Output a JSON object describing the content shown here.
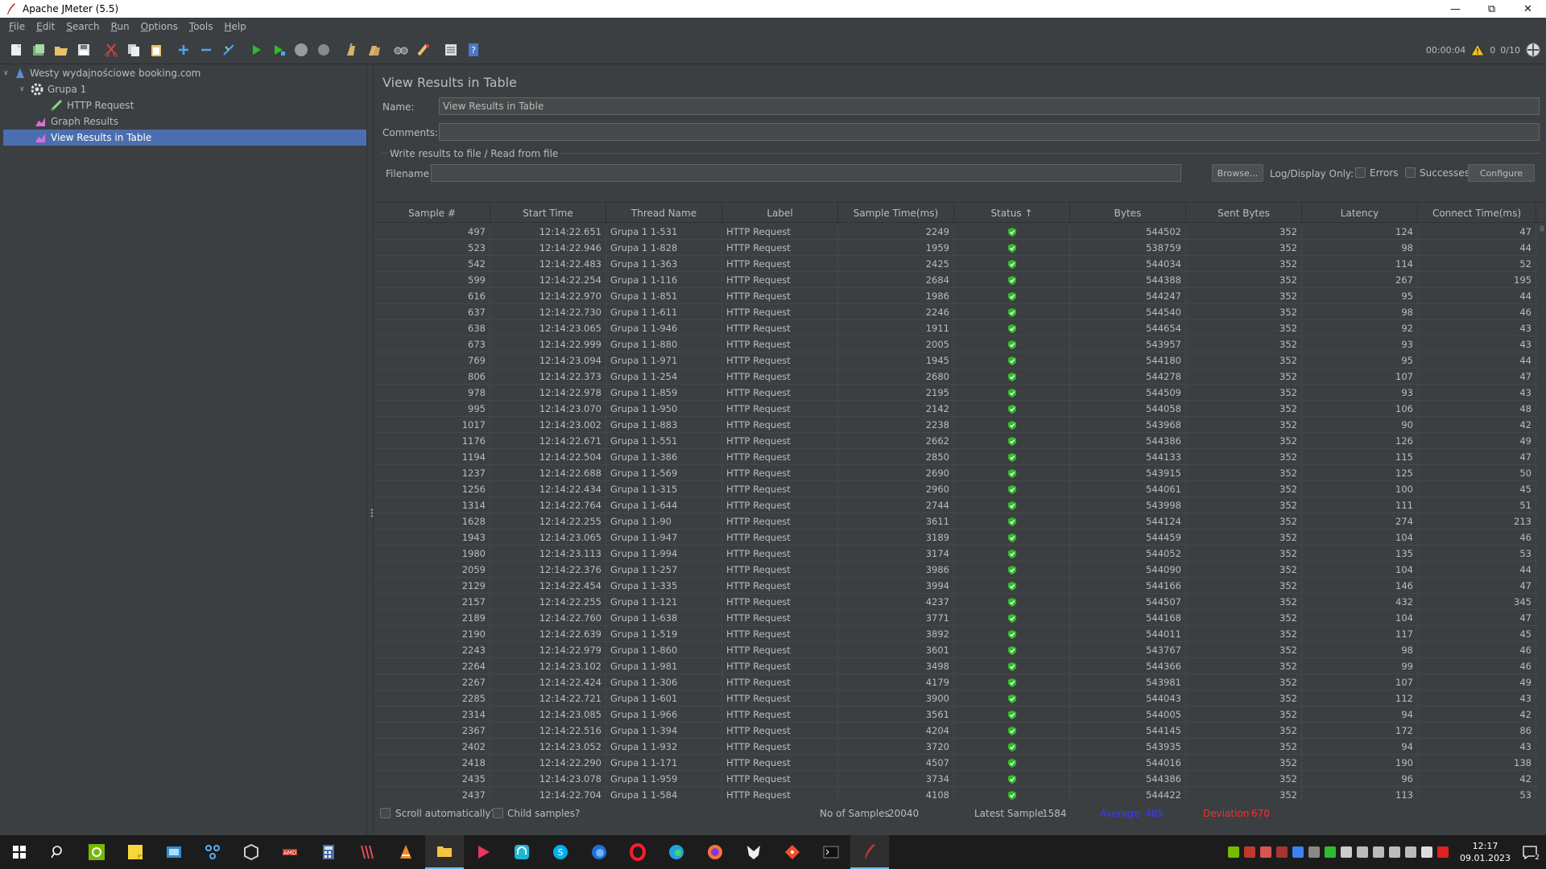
{
  "window": {
    "title": "Apache JMeter (5.5)"
  },
  "menu": [
    "File",
    "Edit",
    "Search",
    "Run",
    "Options",
    "Tools",
    "Help"
  ],
  "toolbar": {
    "timer": "00:00:04",
    "warnings": "0",
    "threads": "0/10",
    "icons": [
      "new-icon",
      "templates-icon",
      "open-icon",
      "save-icon",
      "cut-icon",
      "copy-icon",
      "paste-icon",
      "expand-icon",
      "collapse-icon",
      "toggle-icon",
      "start-icon",
      "start-no-pauses-icon",
      "stop-icon",
      "shutdown-icon",
      "clear-icon",
      "clear-all-icon",
      "search-icon",
      "reset-search-icon",
      "function-helper-icon",
      "help-icon"
    ]
  },
  "tree": {
    "nodes": [
      {
        "label": "Westy wydajnościowe booking.com",
        "icon": "test-plan-icon"
      },
      {
        "label": "Grupa 1",
        "icon": "thread-group-icon"
      },
      {
        "label": "HTTP Request",
        "icon": "sampler-icon"
      },
      {
        "label": "Graph Results",
        "icon": "listener-icon"
      },
      {
        "label": "View Results in Table",
        "icon": "listener-icon"
      }
    ]
  },
  "panel": {
    "title": "View Results in Table",
    "name_label": "Name:",
    "name_value": "View Results in Table",
    "comments_label": "Comments:",
    "comments_value": "",
    "file_group_label": "Write results to file / Read from file",
    "filename_label": "Filename",
    "filename_value": "",
    "browse_label": "Browse...",
    "log_display_label": "Log/Display Only:",
    "errors_label": "Errors",
    "successes_label": "Successes",
    "configure_label": "Configure"
  },
  "table": {
    "columns": [
      "Sample #",
      "Start Time",
      "Thread Name",
      "Label",
      "Sample Time(ms)",
      "Status ↑",
      "Bytes",
      "Sent Bytes",
      "Latency",
      "Connect Time(ms)"
    ],
    "rows": [
      [
        "497",
        "12:14:22.651",
        "Grupa 1 1-531",
        "HTTP Request",
        "2249",
        "544502",
        "352",
        "124",
        "47"
      ],
      [
        "523",
        "12:14:22.946",
        "Grupa 1 1-828",
        "HTTP Request",
        "1959",
        "538759",
        "352",
        "98",
        "44"
      ],
      [
        "542",
        "12:14:22.483",
        "Grupa 1 1-363",
        "HTTP Request",
        "2425",
        "544034",
        "352",
        "114",
        "52"
      ],
      [
        "599",
        "12:14:22.254",
        "Grupa 1 1-116",
        "HTTP Request",
        "2684",
        "544388",
        "352",
        "267",
        "195"
      ],
      [
        "616",
        "12:14:22.970",
        "Grupa 1 1-851",
        "HTTP Request",
        "1986",
        "544247",
        "352",
        "95",
        "44"
      ],
      [
        "637",
        "12:14:22.730",
        "Grupa 1 1-611",
        "HTTP Request",
        "2246",
        "544540",
        "352",
        "98",
        "46"
      ],
      [
        "638",
        "12:14:23.065",
        "Grupa 1 1-946",
        "HTTP Request",
        "1911",
        "544654",
        "352",
        "92",
        "43"
      ],
      [
        "673",
        "12:14:22.999",
        "Grupa 1 1-880",
        "HTTP Request",
        "2005",
        "543957",
        "352",
        "93",
        "43"
      ],
      [
        "769",
        "12:14:23.094",
        "Grupa 1 1-971",
        "HTTP Request",
        "1945",
        "544180",
        "352",
        "95",
        "44"
      ],
      [
        "806",
        "12:14:22.373",
        "Grupa 1 1-254",
        "HTTP Request",
        "2680",
        "544278",
        "352",
        "107",
        "47"
      ],
      [
        "978",
        "12:14:22.978",
        "Grupa 1 1-859",
        "HTTP Request",
        "2195",
        "544509",
        "352",
        "93",
        "43"
      ],
      [
        "995",
        "12:14:23.070",
        "Grupa 1 1-950",
        "HTTP Request",
        "2142",
        "544058",
        "352",
        "106",
        "48"
      ],
      [
        "1017",
        "12:14:23.002",
        "Grupa 1 1-883",
        "HTTP Request",
        "2238",
        "543968",
        "352",
        "90",
        "42"
      ],
      [
        "1176",
        "12:14:22.671",
        "Grupa 1 1-551",
        "HTTP Request",
        "2662",
        "544386",
        "352",
        "126",
        "49"
      ],
      [
        "1194",
        "12:14:22.504",
        "Grupa 1 1-386",
        "HTTP Request",
        "2850",
        "544133",
        "352",
        "115",
        "47"
      ],
      [
        "1237",
        "12:14:22.688",
        "Grupa 1 1-569",
        "HTTP Request",
        "2690",
        "543915",
        "352",
        "125",
        "50"
      ],
      [
        "1256",
        "12:14:22.434",
        "Grupa 1 1-315",
        "HTTP Request",
        "2960",
        "544061",
        "352",
        "100",
        "45"
      ],
      [
        "1314",
        "12:14:22.764",
        "Grupa 1 1-644",
        "HTTP Request",
        "2744",
        "543998",
        "352",
        "111",
        "51"
      ],
      [
        "1628",
        "12:14:22.255",
        "Grupa 1 1-90",
        "HTTP Request",
        "3611",
        "544124",
        "352",
        "274",
        "213"
      ],
      [
        "1943",
        "12:14:23.065",
        "Grupa 1 1-947",
        "HTTP Request",
        "3189",
        "544459",
        "352",
        "104",
        "46"
      ],
      [
        "1980",
        "12:14:23.113",
        "Grupa 1 1-994",
        "HTTP Request",
        "3174",
        "544052",
        "352",
        "135",
        "53"
      ],
      [
        "2059",
        "12:14:22.376",
        "Grupa 1 1-257",
        "HTTP Request",
        "3986",
        "544090",
        "352",
        "104",
        "44"
      ],
      [
        "2129",
        "12:14:22.454",
        "Grupa 1 1-335",
        "HTTP Request",
        "3994",
        "544166",
        "352",
        "146",
        "47"
      ],
      [
        "2157",
        "12:14:22.255",
        "Grupa 1 1-121",
        "HTTP Request",
        "4237",
        "544507",
        "352",
        "432",
        "345"
      ],
      [
        "2189",
        "12:14:22.760",
        "Grupa 1 1-638",
        "HTTP Request",
        "3771",
        "544168",
        "352",
        "104",
        "47"
      ],
      [
        "2190",
        "12:14:22.639",
        "Grupa 1 1-519",
        "HTTP Request",
        "3892",
        "544011",
        "352",
        "117",
        "45"
      ],
      [
        "2243",
        "12:14:22.979",
        "Grupa 1 1-860",
        "HTTP Request",
        "3601",
        "543767",
        "352",
        "98",
        "46"
      ],
      [
        "2264",
        "12:14:23.102",
        "Grupa 1 1-981",
        "HTTP Request",
        "3498",
        "544366",
        "352",
        "99",
        "46"
      ],
      [
        "2267",
        "12:14:22.424",
        "Grupa 1 1-306",
        "HTTP Request",
        "4179",
        "543981",
        "352",
        "107",
        "49"
      ],
      [
        "2285",
        "12:14:22.721",
        "Grupa 1 1-601",
        "HTTP Request",
        "3900",
        "544043",
        "352",
        "112",
        "43"
      ],
      [
        "2314",
        "12:14:23.085",
        "Grupa 1 1-966",
        "HTTP Request",
        "3561",
        "544005",
        "352",
        "94",
        "42"
      ],
      [
        "2367",
        "12:14:22.516",
        "Grupa 1 1-394",
        "HTTP Request",
        "4204",
        "544145",
        "352",
        "172",
        "86"
      ],
      [
        "2402",
        "12:14:23.052",
        "Grupa 1 1-932",
        "HTTP Request",
        "3720",
        "543935",
        "352",
        "94",
        "43"
      ],
      [
        "2418",
        "12:14:22.290",
        "Grupa 1 1-171",
        "HTTP Request",
        "4507",
        "544016",
        "352",
        "190",
        "138"
      ],
      [
        "2435",
        "12:14:23.078",
        "Grupa 1 1-959",
        "HTTP Request",
        "3734",
        "544386",
        "352",
        "96",
        "42"
      ],
      [
        "2437",
        "12:14:22.704",
        "Grupa 1 1-584",
        "HTTP Request",
        "4108",
        "544422",
        "352",
        "113",
        "53"
      ]
    ]
  },
  "footer": {
    "scroll_auto": "Scroll automatically?",
    "child_samples": "Child samples?",
    "no_samples_label": "No of Samples",
    "no_samples_value": "20040",
    "latest_label": "Latest Sample",
    "latest_value": "1584",
    "average_label": "Average",
    "average_value": "485",
    "deviation_label": "Deviation",
    "deviation_value": "670"
  },
  "taskbar": {
    "apps": [
      "windows-start-icon",
      "search-icon",
      "nvidia-icon",
      "sticky-notes-icon",
      "app-icon",
      "network-icon",
      "box-icon",
      "amd-icon",
      "calculator-icon",
      "winrar-icon",
      "vlc-icon",
      "file-explorer-icon",
      "media-player-icon",
      "headset-app-icon",
      "skype-icon",
      "firefox-dev-icon",
      "opera-icon",
      "edge-icon",
      "firefox-icon",
      "fox-icon",
      "git-icon",
      "terminal-icon",
      "jmeter-icon"
    ],
    "time": "12:17",
    "date": "09.01.2023",
    "notifications": "2"
  },
  "colors": {
    "selection": "#4b6eaf",
    "average": "#3a3aff",
    "deviation": "#ff2b2b",
    "status_ok": "#2ebd2e"
  }
}
